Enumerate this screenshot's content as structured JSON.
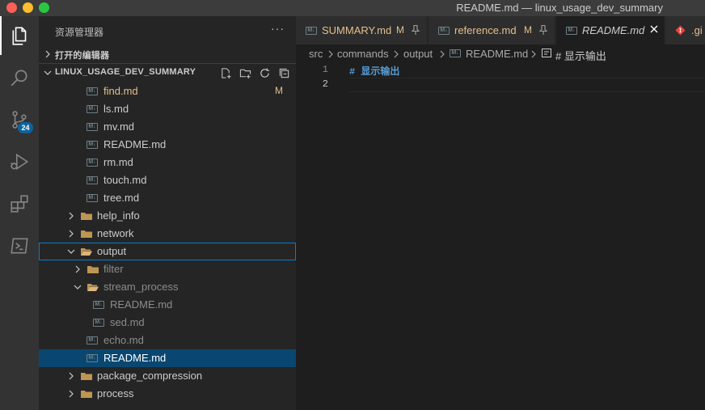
{
  "window": {
    "title": "README.md — linux_usage_dev_summary"
  },
  "activity_bar": {
    "items": [
      {
        "name": "explorer-icon",
        "active": true
      },
      {
        "name": "search-icon"
      },
      {
        "name": "source-control-icon",
        "badge": "24"
      },
      {
        "name": "run-debug-icon"
      },
      {
        "name": "extensions-icon"
      },
      {
        "name": "terminal-icon"
      }
    ]
  },
  "sidebar": {
    "title": "资源管理器",
    "more": "···",
    "open_editors_label": "打开的编辑器",
    "workspace_label": "LINUX_USAGE_DEV_SUMMARY",
    "tree": [
      {
        "name": "find.md",
        "type": "md",
        "status": "M",
        "modified": true
      },
      {
        "name": "ls.md",
        "type": "md"
      },
      {
        "name": "mv.md",
        "type": "md"
      },
      {
        "name": "README.md",
        "type": "md"
      },
      {
        "name": "rm.md",
        "type": "md"
      },
      {
        "name": "touch.md",
        "type": "md"
      },
      {
        "name": "tree.md",
        "type": "md"
      },
      {
        "name": "help_info",
        "type": "folder",
        "expanded": false
      },
      {
        "name": "network",
        "type": "folder",
        "expanded": false
      },
      {
        "name": "output",
        "type": "folder",
        "expanded": true,
        "focused": true
      },
      {
        "name": "filter",
        "type": "folder",
        "expanded": false
      },
      {
        "name": "stream_process",
        "type": "folder",
        "expanded": true
      },
      {
        "name": "README.md",
        "type": "md"
      },
      {
        "name": "sed.md",
        "type": "md"
      },
      {
        "name": "echo.md",
        "type": "md"
      },
      {
        "name": "README.md",
        "type": "md",
        "selected": true
      },
      {
        "name": "package_compression",
        "type": "folder",
        "expanded": false
      },
      {
        "name": "process",
        "type": "folder",
        "expanded": false
      }
    ]
  },
  "tabs": [
    {
      "label": "SUMMARY.md",
      "status": "M",
      "pinned": true,
      "color": "#e2c08d"
    },
    {
      "label": "reference.md",
      "status": "M",
      "pinned": true,
      "color": "#e2c08d"
    },
    {
      "label": "README.md",
      "active": true,
      "preview": true,
      "color": "#cccccc"
    },
    {
      "label": ".gi",
      "icon": "git-icon",
      "color": "#e2c08d"
    }
  ],
  "breadcrumb": [
    "src",
    "commands",
    "output",
    "README.md",
    "# 显示输出"
  ],
  "editor": {
    "lines": [
      {
        "number": "1",
        "text": "# 显示输出"
      },
      {
        "number": "2",
        "text": ""
      }
    ]
  },
  "colors": {
    "modified": "#e2c08d",
    "heading": "#569cd6",
    "folder": "#c09553",
    "selection": "#094771",
    "focus": "#007fd4"
  }
}
